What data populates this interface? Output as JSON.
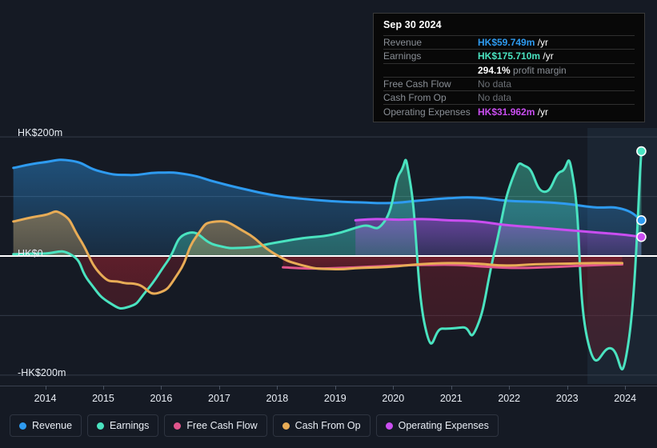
{
  "background_color": "#151a24",
  "tooltip": {
    "date": "Sep 30 2024",
    "rows": [
      {
        "key": "Revenue",
        "amount": "HK$59.749m",
        "unit": " /yr",
        "color": "#2e9bf0",
        "no_data": false
      },
      {
        "key": "Earnings",
        "amount": "HK$175.710m",
        "unit": " /yr",
        "color": "#4ae3c0",
        "no_data": false
      },
      {
        "key": "",
        "amount": "294.1%",
        "unit": " profit margin",
        "color": "#ffffff",
        "margin": true
      },
      {
        "key": "Free Cash Flow",
        "amount": "No data",
        "unit": "",
        "color": "#6b6f75",
        "no_data": true
      },
      {
        "key": "Cash From Op",
        "amount": "No data",
        "unit": "",
        "color": "#6b6f75",
        "no_data": true
      },
      {
        "key": "Operating Expenses",
        "amount": "HK$31.962m",
        "unit": " /yr",
        "color": "#c94ef0",
        "no_data": false
      }
    ]
  },
  "legend": {
    "items": [
      {
        "label": "Revenue",
        "color": "#2e9bf0"
      },
      {
        "label": "Earnings",
        "color": "#4ae3c0"
      },
      {
        "label": "Free Cash Flow",
        "color": "#e0558c"
      },
      {
        "label": "Cash From Op",
        "color": "#e8ac56"
      },
      {
        "label": "Operating Expenses",
        "color": "#c94ef0"
      }
    ]
  },
  "chart_data": {
    "type": "line",
    "title": "",
    "xlabel": "",
    "ylabel": "HK$",
    "currency": "HK$",
    "unit": "m",
    "grid": true,
    "legend_position": "bottom",
    "highlight_band": {
      "from_x": 2023.85,
      "to_x": 2025.05,
      "note": "latest period shading"
    },
    "x_tick_labels": [
      "2014",
      "2015",
      "2016",
      "2017",
      "2018",
      "2019",
      "2020",
      "2021",
      "2022",
      "2023",
      "2024"
    ],
    "x_ticks": [
      2014,
      2015,
      2016,
      2017,
      2018,
      2019,
      2020,
      2021,
      2022,
      2023,
      2024
    ],
    "y_tick_labels": [
      "HK$200m",
      "HK$0",
      "-HK$200m"
    ],
    "y_ticks": [
      200,
      0,
      -200
    ],
    "y_gridlines": [
      200,
      100,
      0,
      -100,
      -200
    ],
    "ylim": [
      -215,
      215
    ],
    "xlim": [
      2013.72,
      2025.05
    ],
    "zero_line": 0,
    "series": [
      {
        "name": "Revenue",
        "color": "#2e9bf0",
        "fill": true,
        "x": [
          2013.95,
          2014.45,
          2014.95,
          2015.45,
          2015.95,
          2016.45,
          2016.95,
          2017.45,
          2017.95,
          2018.45,
          2018.95,
          2019.45,
          2019.95,
          2020.45,
          2020.95,
          2021.45,
          2021.95,
          2022.45,
          2022.95,
          2023.45,
          2023.95,
          2024.45,
          2024.78
        ],
        "values": [
          148,
          157,
          160,
          142,
          136,
          140,
          137,
          124,
          112,
          102,
          96,
          92,
          90,
          89,
          93,
          97,
          98,
          93,
          91,
          88,
          82,
          79,
          60
        ],
        "endpoint_marker": true,
        "endpoint_value": 59.749
      },
      {
        "name": "Earnings",
        "color": "#4ae3c0",
        "fill": true,
        "x": [
          2013.95,
          2014.45,
          2014.95,
          2015.25,
          2015.6,
          2015.95,
          2016.25,
          2016.6,
          2016.95,
          2017.45,
          2017.95,
          2018.45,
          2018.95,
          2019.45,
          2019.95,
          2020.35,
          2020.62,
          2020.8,
          2021.05,
          2021.35,
          2021.7,
          2021.95,
          2022.25,
          2022.55,
          2022.8,
          2023.1,
          2023.4,
          2023.62,
          2023.85,
          2024.25,
          2024.55,
          2024.78
        ],
        "values": [
          3,
          4,
          2,
          -42,
          -78,
          -85,
          -58,
          -10,
          38,
          18,
          14,
          22,
          30,
          36,
          50,
          58,
          140,
          120,
          -118,
          -122,
          -120,
          -118,
          8,
          128,
          150,
          108,
          142,
          120,
          -140,
          -155,
          -150,
          176
        ],
        "endpoint_marker": true,
        "endpoint_value": 175.71
      },
      {
        "name": "Free Cash Flow",
        "color": "#e0558c",
        "fill": true,
        "x": [
          2018.6,
          2019.1,
          2019.6,
          2020.1,
          2020.6,
          2021.1,
          2021.6,
          2022.1,
          2022.6,
          2023.1,
          2023.6,
          2024.1,
          2024.45
        ],
        "values": [
          -19,
          -21,
          -20,
          -18,
          -16,
          -15,
          -15,
          -18,
          -20,
          -19,
          -17,
          -15,
          -14
        ],
        "endpoint_marker": false
      },
      {
        "name": "Cash From Op",
        "color": "#e8ac56",
        "fill": true,
        "x": [
          2013.95,
          2014.45,
          2014.8,
          2015.1,
          2015.45,
          2015.8,
          2016.1,
          2016.45,
          2016.8,
          2017.1,
          2017.45,
          2017.95,
          2018.45,
          2018.95,
          2019.45,
          2019.95,
          2020.45,
          2020.95,
          2021.45,
          2021.95,
          2022.45,
          2022.95,
          2023.45,
          2023.95,
          2024.45
        ],
        "values": [
          58,
          68,
          70,
          28,
          -30,
          -44,
          -48,
          -62,
          -28,
          32,
          58,
          40,
          4,
          -16,
          -22,
          -20,
          -18,
          -14,
          -12,
          -13,
          -16,
          -14,
          -13,
          -12,
          -12
        ],
        "endpoint_marker": false
      },
      {
        "name": "Operating Expenses",
        "color": "#c94ef0",
        "fill": true,
        "x": [
          2019.85,
          2020.2,
          2020.6,
          2021.0,
          2021.45,
          2021.95,
          2022.45,
          2022.95,
          2023.45,
          2023.95,
          2024.45,
          2024.78
        ],
        "values": [
          60,
          62,
          61,
          62,
          60,
          58,
          52,
          48,
          44,
          40,
          36,
          32
        ],
        "endpoint_marker": true,
        "endpoint_value": 31.962
      }
    ]
  }
}
